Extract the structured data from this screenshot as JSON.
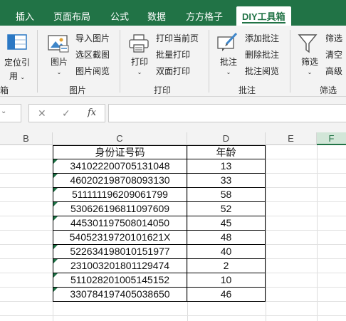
{
  "tabs": [
    {
      "label": "插入"
    },
    {
      "label": "页面布局"
    },
    {
      "label": "公式"
    },
    {
      "label": "数据"
    },
    {
      "label": "方方格子"
    },
    {
      "label": "DIY工具箱"
    }
  ],
  "ribbon": {
    "groups": {
      "group1_label": "箱",
      "group2_label": "图片",
      "group3_label": "打印",
      "group4_label": "批注",
      "group5_label": "筛选"
    },
    "locate_ref": {
      "line1": "定位引",
      "line2": "用"
    },
    "picture_big": "图片",
    "picture_items": [
      "导入图片",
      "选区截图",
      "图片阅览"
    ],
    "print_big": "打印",
    "print_items": [
      "打印当前页",
      "批量打印",
      "双面打印"
    ],
    "comment_big": "批注",
    "comment_items": [
      "添加批注",
      "删除批注",
      "批注阅览"
    ],
    "filter_big": "筛选",
    "filter_items": [
      "筛选",
      "清空",
      "高级"
    ]
  },
  "formula_bar": {
    "cancel_symbol": "✕",
    "enter_symbol": "✓",
    "fx_symbol": "fx",
    "value": ""
  },
  "columns": [
    "B",
    "C",
    "D",
    "E",
    "F"
  ],
  "table": {
    "headers": [
      "身份证号码",
      "年龄"
    ],
    "rows": [
      [
        "341022200705131048",
        "13"
      ],
      [
        "460202198708093130",
        "33"
      ],
      [
        "511111196209061799",
        "58"
      ],
      [
        "530626196811097609",
        "52"
      ],
      [
        "445301197508014050",
        "45"
      ],
      [
        "54052319720101621X",
        "48"
      ],
      [
        "522634198010151977",
        "40"
      ],
      [
        "231003201801129474",
        "2"
      ],
      [
        "511028201005145152",
        "10"
      ],
      [
        "330784197405038650",
        "46"
      ]
    ]
  },
  "colors": {
    "accent": "#217346",
    "error_marker": "#1e7145"
  }
}
